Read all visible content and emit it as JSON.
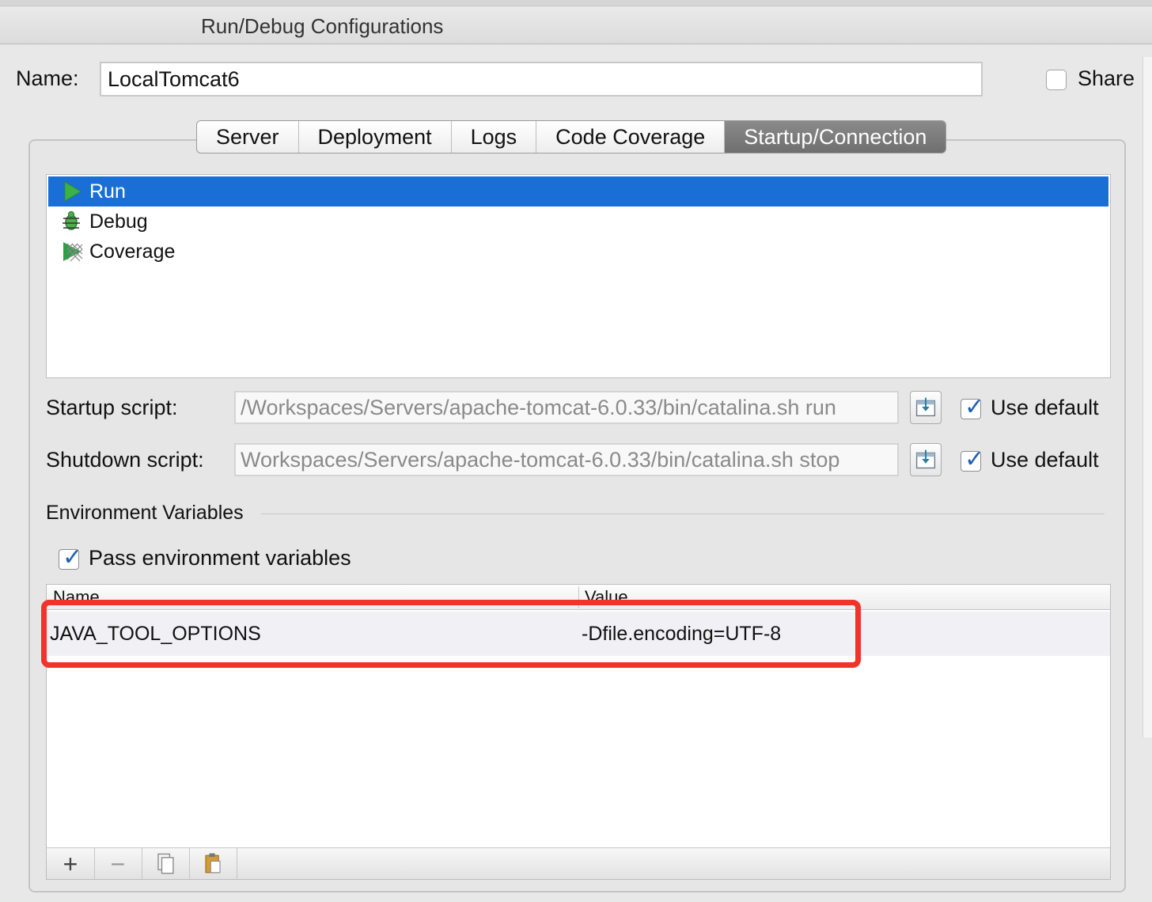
{
  "window": {
    "title": "Run/Debug Configurations"
  },
  "name_row": {
    "label": "Name:",
    "value": "LocalTomcat6",
    "share_label": "Share",
    "share_checked": false
  },
  "tabs": [
    {
      "label": "Server",
      "active": false
    },
    {
      "label": "Deployment",
      "active": false
    },
    {
      "label": "Logs",
      "active": false
    },
    {
      "label": "Code Coverage",
      "active": false
    },
    {
      "label": "Startup/Connection",
      "active": true
    }
  ],
  "modes": [
    {
      "label": "Run",
      "icon": "run-icon",
      "selected": true
    },
    {
      "label": "Debug",
      "icon": "debug-icon",
      "selected": false
    },
    {
      "label": "Coverage",
      "icon": "coverage-icon",
      "selected": false
    }
  ],
  "startup": {
    "label": "Startup script:",
    "value": "/Workspaces/Servers/apache-tomcat-6.0.33/bin/catalina.sh run",
    "use_default_label": "Use default",
    "use_default": true
  },
  "shutdown": {
    "label": "Shutdown script:",
    "value": "Workspaces/Servers/apache-tomcat-6.0.33/bin/catalina.sh stop",
    "use_default_label": "Use default",
    "use_default": true
  },
  "env": {
    "section_title": "Environment Variables",
    "pass_label": "Pass environment variables",
    "pass_checked": true,
    "columns": [
      "Name",
      "Value"
    ],
    "rows": [
      {
        "name": "JAVA_TOOL_OPTIONS",
        "value": "-Dfile.encoding=UTF-8"
      }
    ]
  },
  "toolbar": {
    "add": "+",
    "remove": "−"
  },
  "colors": {
    "selection": "#1a6fd6",
    "highlight": "#f0332b",
    "checkmark": "#1f5fb5"
  }
}
